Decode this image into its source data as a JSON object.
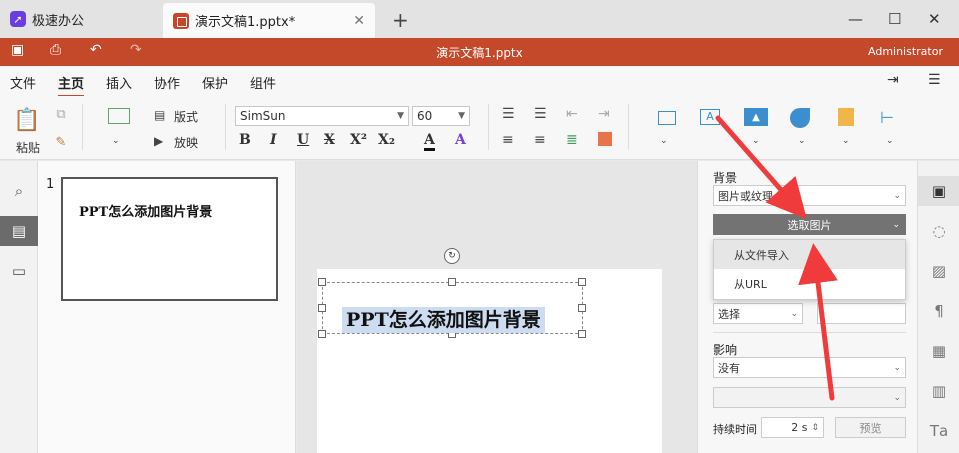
{
  "tabs": [
    {
      "label": "极速办公",
      "icon": "rocket-icon"
    },
    {
      "label": "演示文稿1.pptx*",
      "icon": "presentation-icon"
    }
  ],
  "titlebar": {
    "title": "演示文稿1.pptx",
    "user": "Administrator"
  },
  "menu": [
    "文件",
    "主页",
    "插入",
    "协作",
    "保护",
    "组件"
  ],
  "ribbon": {
    "paste": "粘贴",
    "layout": "版式",
    "slideshow": "放映",
    "font": "SimSun",
    "size": "60",
    "bold": "B",
    "italic": "I",
    "underline": "U",
    "strike": "X",
    "sup": "X²",
    "sub": "X₂",
    "font_color": "A",
    "highlight": "A"
  },
  "slide_panel": {
    "number": "1",
    "thumb_text": "PPT怎么添加图片背景"
  },
  "slide": {
    "text": "PPT怎么添加图片背景"
  },
  "props": {
    "background_label": "背景",
    "fill_type": "图片或纹理",
    "select_image": "选取图片",
    "menu_items": [
      "从文件导入",
      "从URL"
    ],
    "select_label": "选择",
    "effect_label": "影响",
    "effect_value": "没有",
    "duration_label": "持续时间",
    "duration_value": "2 s",
    "preview": "预览"
  },
  "colors": {
    "accent": "#c4482a",
    "arrow": "#ef3b3b"
  }
}
